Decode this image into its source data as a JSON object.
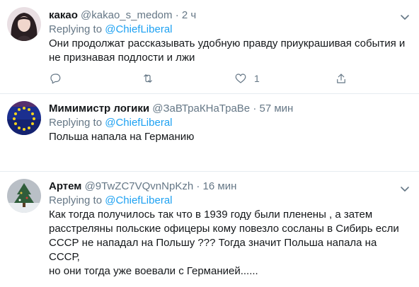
{
  "tweets": [
    {
      "name": "какао",
      "handle": "@kakao_s_medom",
      "dot": "·",
      "time": "2 ч",
      "replying_prefix": "Replying to",
      "replying_to": "@ChiefLiberal",
      "text_lines": [
        "Они продолжат рассказывать удобную правду приукрашивая события и",
        "не признавая подлости и лжи"
      ],
      "like_count": "1"
    },
    {
      "name": "Мимимистр логики",
      "handle": "@ЗаВТраКНаТраВе",
      "dot": "·",
      "time": "57 мин",
      "replying_prefix": "Replying to",
      "replying_to": "@ChiefLiberal",
      "text_lines": [
        "Польша напала на Германию"
      ]
    },
    {
      "name": "Артем",
      "handle": "@9TwZC7VQvnNpKzh",
      "dot": "·",
      "time": "16 мин",
      "replying_prefix": "Replying to",
      "replying_to": "@ChiefLiberal",
      "text_lines": [
        "Как тогда получилось так что в 1939 году были пленены , а затем",
        "расстреляны польские офицеры  кому повезло сосланы в Сибирь если",
        "СССР не нападал на Польшу ??? Тогда значит Польша напала на СССР,",
        "но они тогда уже воевали с Германией......"
      ]
    }
  ],
  "icons": {
    "reply": "reply-icon",
    "retweet": "retweet-icon",
    "like": "heart-icon",
    "share": "share-icon",
    "more": "chevron-down-icon"
  },
  "colors": {
    "accent": "#1da1f2",
    "muted": "#657786",
    "divider": "#e6ecf0"
  }
}
